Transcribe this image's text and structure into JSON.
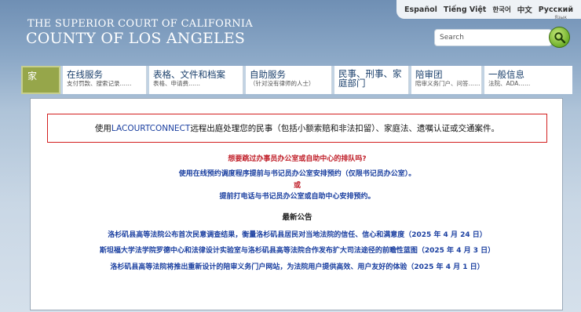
{
  "header": {
    "court_line1": "THE SUPERIOR COURT OF CALIFORNIA",
    "court_line2": "COUNTY OF LOS ANGELES"
  },
  "languages": [
    "Español",
    "Tiếng Việt",
    "한국어",
    "中文",
    "Русский"
  ],
  "language_sub": "Язык",
  "search": {
    "placeholder": "Search"
  },
  "nav": {
    "home": "家",
    "tabs": [
      {
        "title": "在线服务",
        "subtitle": "支付罚款、搜索记录……"
      },
      {
        "title": "表格、文件和档案",
        "subtitle": "表格、申请费……"
      },
      {
        "title": "自助服务",
        "subtitle": "（针对没有律师的人士）"
      },
      {
        "title": "民事、刑事、家庭部门",
        "subtitle": ""
      },
      {
        "title": "陪审团",
        "subtitle": "陪审义务门户、问答……"
      },
      {
        "title": "一般信息",
        "subtitle": "法院、ADA……"
      }
    ]
  },
  "alert": {
    "prefix": "使用",
    "link": "LACOURTCONNECT",
    "suffix": "远程出庭处理您的民事（包括小额索赔和非法扣留）、家庭法、遗嘱认证或交通案件。"
  },
  "queue": {
    "question": "想要跳过办事员办公室或自助中心的排队吗?",
    "option1": "使用在线预约调度程序提前与书记员办公室安排预约（仅限书记员办公室）。",
    "or": "或",
    "option2": "提前打电话与书记员办公室或自助中心安排预约。"
  },
  "news": {
    "title": "最新公告",
    "items": [
      "洛杉矶县高等法院公布首次民意调查结果，衡量洛杉矶县居民对当地法院的信任、信心和满意度（2025 年 4 月 24 日）",
      "斯坦福大学法学院罗德中心和法律设计实验室与洛杉矶县高等法院合作发布扩大司法途径的前瞻性蓝图（2025 年 4 月 3 日）",
      "洛杉矶县高等法院将推出重新设计的陪审义务门户网站，为法院用户提供高效、用户友好的体验（2025 年 4 月 1 日）"
    ]
  }
}
